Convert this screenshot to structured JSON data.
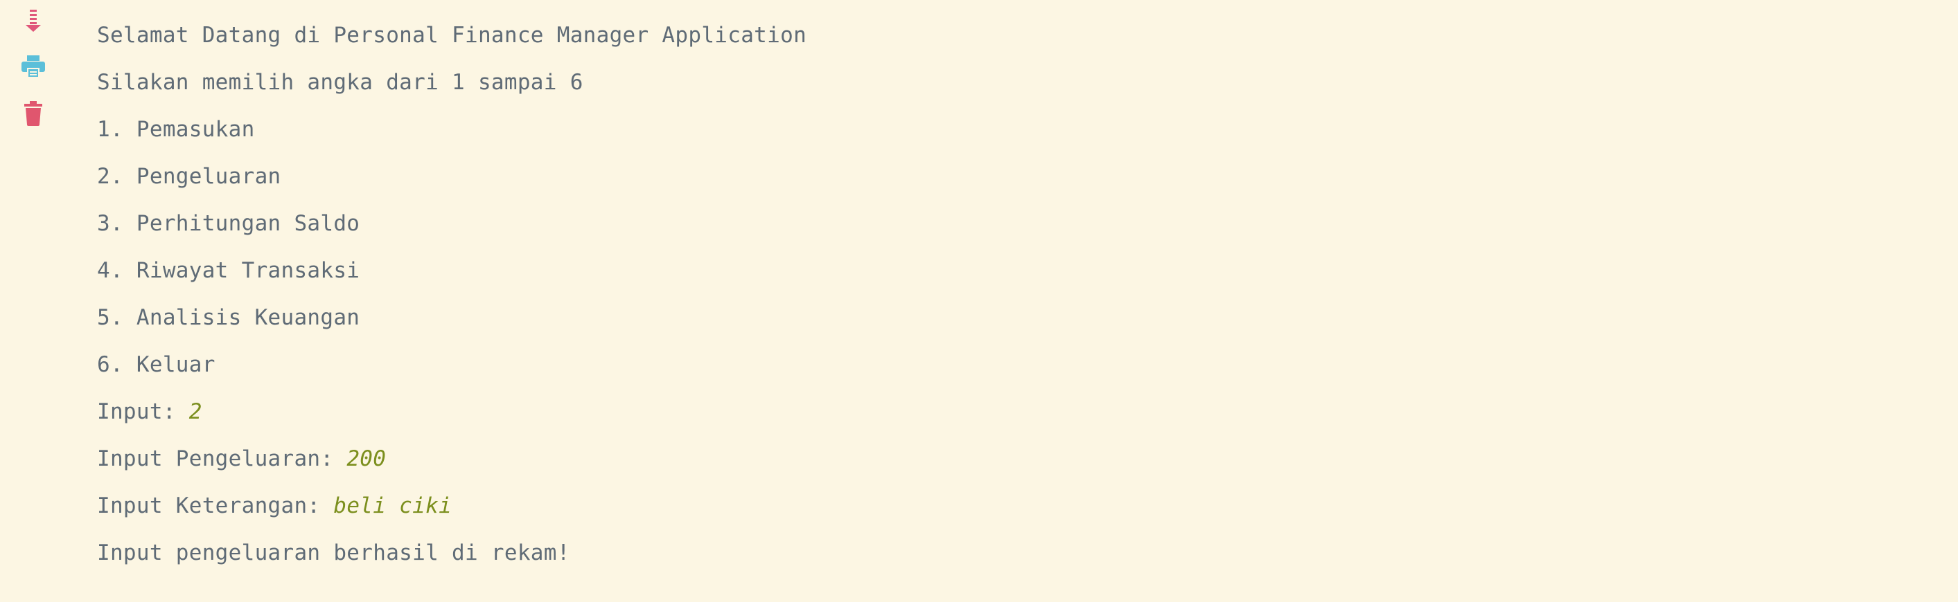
{
  "toolbar": {
    "scroll_to_end_icon": "scroll-to-end-icon",
    "print_icon": "printer-icon",
    "clear_icon": "trash-icon"
  },
  "colors": {
    "background": "#fcf6e3",
    "output_text": "#5f6b76",
    "user_input": "#7c8f1e",
    "scroll_icon": "#e0567a",
    "print_icon": "#5bbfd9",
    "trash_icon": "#e0566e"
  },
  "console": {
    "lines": [
      {
        "text": "Selamat Datang di Personal Finance Manager Application"
      },
      {
        "text": "Silakan memilih angka dari 1 sampai 6"
      },
      {
        "text": "1. Pemasukan"
      },
      {
        "text": "2. Pengeluaran"
      },
      {
        "text": "3. Perhitungan Saldo"
      },
      {
        "text": "4. Riwayat Transaksi"
      },
      {
        "text": "5. Analisis Keuangan"
      },
      {
        "text": "6. Keluar"
      },
      {
        "prompt": "Input: ",
        "input": "2"
      },
      {
        "prompt": "Input Pengeluaran: ",
        "input": "200"
      },
      {
        "prompt": "Input Keterangan: ",
        "input": "beli ciki"
      },
      {
        "text": "Input pengeluaran berhasil di rekam!"
      }
    ]
  }
}
